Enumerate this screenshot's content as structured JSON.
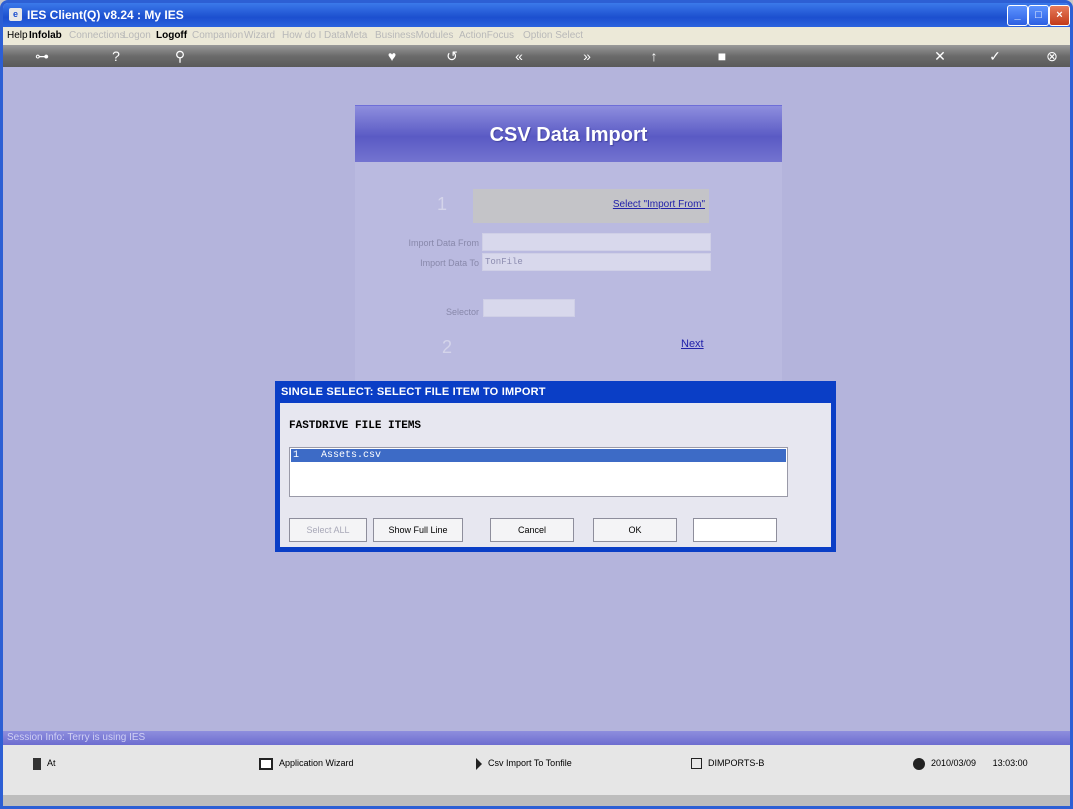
{
  "window": {
    "title": "IES Client(Q) v8.24 : My IES",
    "minimize": "_",
    "maximize": "□",
    "close": "×"
  },
  "menu": {
    "items": [
      {
        "label": "Help",
        "enabled": true
      },
      {
        "label": "Infolab",
        "enabled": true
      },
      {
        "label": "Connections",
        "enabled": false
      },
      {
        "label": "Logon",
        "enabled": false
      },
      {
        "label": "Logoff",
        "enabled": true
      },
      {
        "label": "Companion",
        "enabled": false
      },
      {
        "label": "Wizard",
        "enabled": false
      },
      {
        "label": "How do I",
        "enabled": false
      },
      {
        "label": "DataMeta",
        "enabled": false
      },
      {
        "label": "BusinessModules",
        "enabled": false
      },
      {
        "label": "ActionFocus",
        "enabled": false
      },
      {
        "label": "Option Select",
        "enabled": false
      }
    ]
  },
  "toolbar": {
    "key": "⊶",
    "help": "?",
    "search": "⚲",
    "heart": "♥",
    "undo": "↺",
    "back": "«",
    "forward": "»",
    "up": "↑",
    "stop": "■",
    "cancel": "✕",
    "confirm": "✓",
    "close": "⊗"
  },
  "wizard": {
    "heading": "CSV Data Import",
    "step1": "1",
    "step1_link": "Select \"Import From\"",
    "import_from_label": "Import Data From",
    "import_from_value": "",
    "import_to_label": "Import Data To",
    "import_to_value": "TonFile",
    "selector_label": "Selector",
    "selector_value": "",
    "step2": "2",
    "next_link": "Next"
  },
  "dialog": {
    "title": "SINGLE SELECT: SELECT FILE ITEM TO IMPORT",
    "subtitle": "FASTDRIVE FILE ITEMS",
    "items": [
      {
        "num": "1",
        "value": "Assets.csv",
        "selected": true
      }
    ],
    "buttons": {
      "select_all": "Select ALL",
      "show_full_line": "Show Full Line",
      "cancel": "Cancel",
      "ok": "OK"
    },
    "input_value": ""
  },
  "status_strip": "Session Info: Terry is using IES",
  "bottombar": {
    "items": [
      {
        "label": "At"
      },
      {
        "label": "Application Wizard"
      },
      {
        "label": "Csv Import To Tonfile"
      },
      {
        "label": "DIMPORTS-B"
      }
    ],
    "date": "2010/03/09",
    "time": "13:03:00"
  }
}
